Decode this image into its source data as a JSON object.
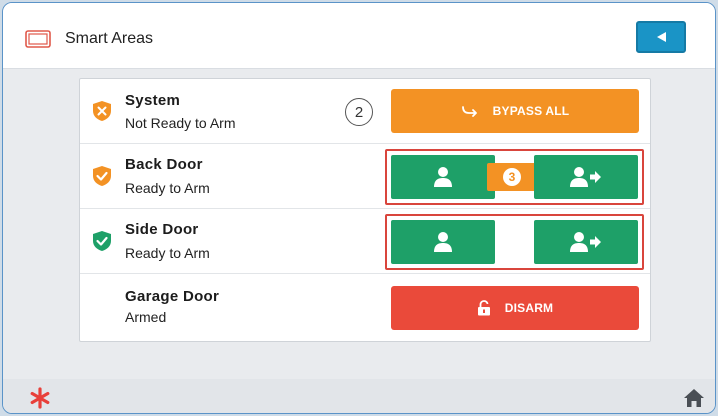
{
  "header": {
    "title": "Smart Areas",
    "icon": "panel-icon",
    "back_icon": "back-arrow-icon"
  },
  "zones": [
    {
      "name": "System",
      "status": "Not Ready to Arm",
      "count": "2",
      "action_label": "BYPASS ALL",
      "icon": "shield-x-icon",
      "icon_color": "#f39224"
    },
    {
      "name": "Back Door",
      "status": "Ready to Arm",
      "badge": "3",
      "icon": "shield-check-icon",
      "icon_color": "#f39224"
    },
    {
      "name": "Side Door",
      "status": "Ready to Arm",
      "icon": "shield-check-icon",
      "icon_color": "#1ea068"
    },
    {
      "name": "Garage Door",
      "status": "Armed",
      "action_label": "DISARM"
    }
  ],
  "footer": {
    "left_icon": "emergency-asterisk-icon",
    "right_icon": "home-icon"
  },
  "colors": {
    "accent_blue": "#1a94c6",
    "orange": "#f39224",
    "green": "#1ea068",
    "red": "#ea4a3a"
  }
}
